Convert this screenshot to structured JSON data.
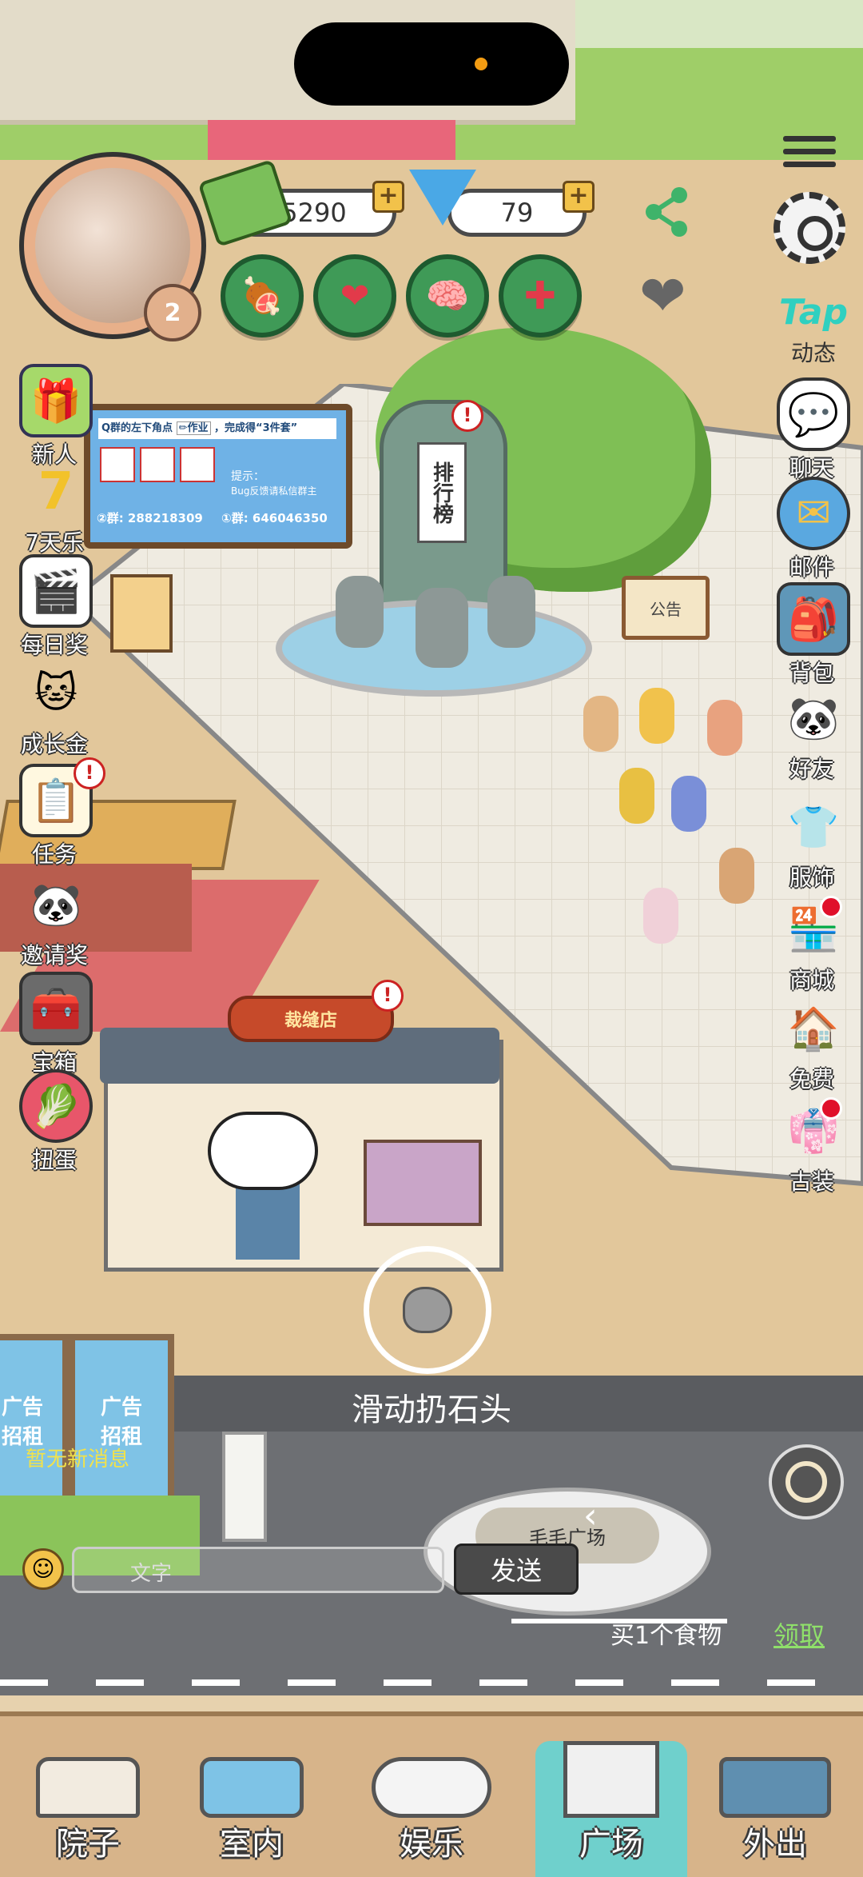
{
  "player": {
    "level": "2"
  },
  "currency": {
    "cash": "5290",
    "gems": "79"
  },
  "stats": [
    {
      "name": "food-stat-icon",
      "glyph": "🍖"
    },
    {
      "name": "heart-stat-icon",
      "glyph": "❤"
    },
    {
      "name": "brain-stat-icon",
      "glyph": "🧠"
    },
    {
      "name": "health-stat-icon",
      "glyph": "✚"
    }
  ],
  "left_menu": [
    {
      "label": "新人",
      "glyph": "🎁"
    },
    {
      "label": "7天乐",
      "glyph": "7"
    },
    {
      "label": "每日奖",
      "glyph": "🎬"
    },
    {
      "label": "成长金",
      "glyph": "🐱"
    },
    {
      "label": "任务",
      "glyph": "📋"
    },
    {
      "label": "邀请奖",
      "glyph": "🐼"
    },
    {
      "label": "宝箱",
      "glyph": "🧰"
    },
    {
      "label": "扭蛋",
      "glyph": "🥬"
    }
  ],
  "right_menu": [
    {
      "label": "动态",
      "glyph": "Tap"
    },
    {
      "label": "聊天",
      "glyph": "💬"
    },
    {
      "label": "邮件",
      "glyph": "✉"
    },
    {
      "label": "背包",
      "glyph": "🎒"
    },
    {
      "label": "好友",
      "glyph": "🐼"
    },
    {
      "label": "服饰",
      "glyph": "👕"
    },
    {
      "label": "商城",
      "glyph": "🏪"
    },
    {
      "label": "免费",
      "glyph": "🏠"
    },
    {
      "label": "古装",
      "glyph": "👘"
    }
  ],
  "notice_board": {
    "line1": "Q群的左下角点",
    "tag": "✏作业",
    "line1b": "，完成得“3件套”",
    "tip_label": "提示：",
    "tip_text": "Bug反馈请私信群主",
    "group2": "②群: 288218309",
    "group1": "①群: 646046350"
  },
  "landmarks": {
    "ranking": "排行榜",
    "announcement": "公告",
    "tailor": "裁缝店",
    "plaza": "毛毛广场"
  },
  "throw_hint": "滑动扔石头",
  "billboards": [
    {
      "line1": "广告",
      "line2": "招租"
    },
    {
      "line1": "广告",
      "line2": "招租"
    }
  ],
  "chat": {
    "no_message": "暂无新消息",
    "input_placeholder": "文字",
    "send_label": "发送"
  },
  "task_banner": {
    "text": "买1个食物",
    "claim": "领取"
  },
  "bottom_nav": [
    {
      "label": "院子"
    },
    {
      "label": "室内"
    },
    {
      "label": "娱乐"
    },
    {
      "label": "广场"
    },
    {
      "label": "外出"
    }
  ]
}
